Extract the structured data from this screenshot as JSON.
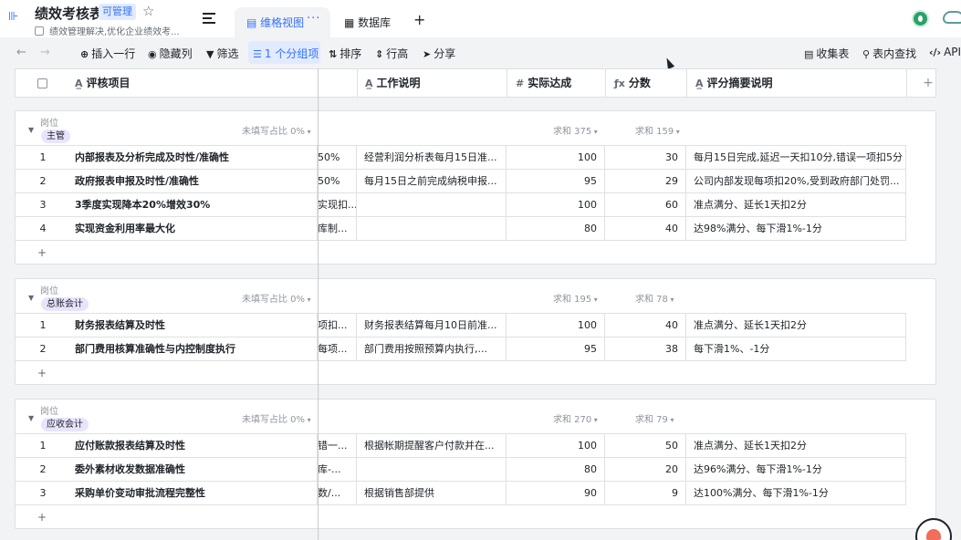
{
  "header": {
    "title": "绩效考核表",
    "perm_badge": "可管理",
    "description": "绩效管理解决,优化企业绩效考...",
    "tabs": [
      {
        "label": "维格视图",
        "active": true
      },
      {
        "label": "数据库",
        "active": false
      }
    ],
    "tab_more": "···",
    "tab_add": "+"
  },
  "toolbar": {
    "insert_row": "插入一行",
    "hide_fields": "隐藏列",
    "filter": "筛选",
    "group": "1 个分组项",
    "sort": "排序",
    "row_height": "行高",
    "share": "分享",
    "form": "收集表",
    "find": "表内查找",
    "api": "API"
  },
  "columns": {
    "item": "评核项目",
    "work": "工作说明",
    "achieved": "实际达成",
    "score": "分数",
    "summary": "评分摘要说明"
  },
  "colors": {
    "accent": "#3370ff",
    "tag_bg": "#e8e4fb"
  },
  "group_field_label": "岗位",
  "empty_ratio_label": "未填写占比 0%",
  "add_row": "+",
  "groups": [
    {
      "tag": "主管",
      "sum_achieved": "求和 375",
      "sum_score": "求和 159",
      "rows": [
        {
          "idx": "1",
          "item": "内部报表及分析完成及时性/准确性",
          "bus": "50%",
          "work": "经营利润分析表每月15日准...",
          "achieved": "100",
          "score": "30",
          "summary": "每月15日完成,延迟一天扣10分,错误一项扣5分"
        },
        {
          "idx": "2",
          "item": "政府报表申报及时性/准确性",
          "bus": "50%",
          "work": "每月15日之前完成纳税申报...",
          "achieved": "95",
          "score": "29",
          "summary": "公司内部发现每项扣20%,受到政府部门处罚..."
        },
        {
          "idx": "3",
          "item": "3季度实现降本20%增效30%",
          "bus": "实现扣...",
          "work": "",
          "achieved": "100",
          "score": "60",
          "summary": "准点满分、延长1天扣2分"
        },
        {
          "idx": "4",
          "item": "实现资金利用率最大化",
          "bus": "库制...",
          "work": "",
          "achieved": "80",
          "score": "40",
          "summary": "达98%满分、每下滑1%-1分"
        }
      ]
    },
    {
      "tag": "总账会计",
      "sum_achieved": "求和 195",
      "sum_score": "求和 78",
      "rows": [
        {
          "idx": "1",
          "item": "财务报表结算及时性",
          "bus": "项扣...",
          "work": "财务报表结算每月10日前准...",
          "achieved": "100",
          "score": "40",
          "summary": "准点满分、延长1天扣2分"
        },
        {
          "idx": "2",
          "item": "部门费用核算准确性与内控制度执行",
          "bus": "每项...",
          "work": "部门费用按照预算内执行,...",
          "achieved": "95",
          "score": "38",
          "summary": "每下滑1%、-1分"
        }
      ]
    },
    {
      "tag": "应收会计",
      "sum_achieved": "求和 270",
      "sum_score": "求和 79",
      "rows": [
        {
          "idx": "1",
          "item": "应付账款报表结算及时性",
          "bus": "错一...",
          "work": "根据帐期提醒客户付款并在...",
          "achieved": "100",
          "score": "50",
          "summary": "准点满分、延长1天扣2分"
        },
        {
          "idx": "2",
          "item": "委外素材收发数据准确性",
          "bus": "库-...",
          "work": "",
          "achieved": "80",
          "score": "20",
          "summary": "达96%满分、每下滑1%-1分"
        },
        {
          "idx": "3",
          "item": "采购单价变动审批流程完整性",
          "bus": "数/...",
          "work": "根据销售部提供",
          "achieved": "90",
          "score": "9",
          "summary": "达100%满分、每下滑1%-1分"
        }
      ]
    }
  ]
}
